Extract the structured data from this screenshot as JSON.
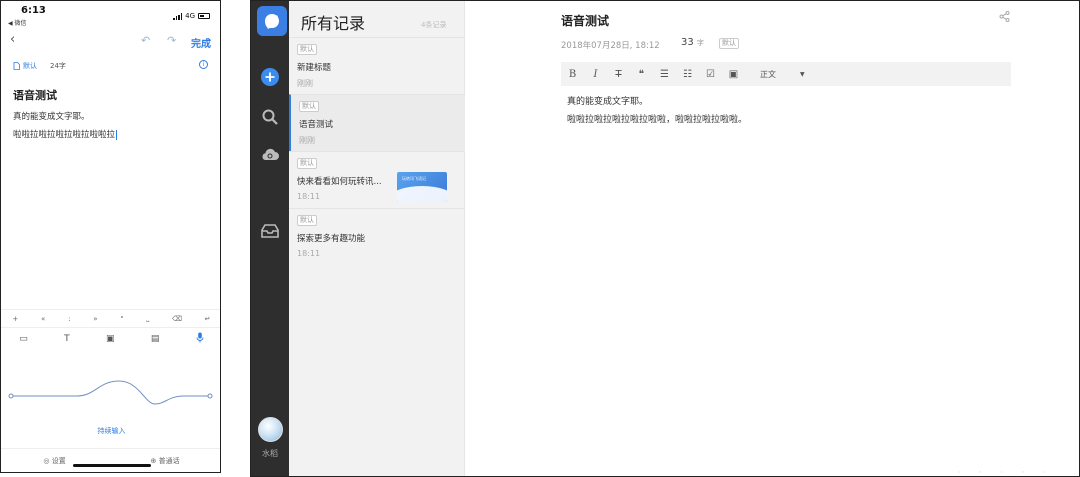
{
  "phone": {
    "status": {
      "time": "6:13",
      "back_app": "◀ 微信",
      "network": "4G"
    },
    "nav": {
      "back_icon": "‹",
      "undo_icon": "↶",
      "redo_icon": "↷",
      "done_label": "完成"
    },
    "meta": {
      "notebook": "默认",
      "word_count": "24字",
      "info_icon": "i"
    },
    "note": {
      "title": "语音测试",
      "line1": "真的能变成文字耶。",
      "line2": "啦啦拉啦拉啦拉啦拉啦啦拉"
    },
    "key_row": [
      "+",
      "«",
      ":",
      "»",
      "\"",
      "⎵",
      "⌫",
      "↵"
    ],
    "tool_row": {
      "image_icon": "▭",
      "text_icon": "T",
      "chat_icon": "▣",
      "card_icon": "▤",
      "mic_icon": "🎤"
    },
    "listening_label": "持续输入",
    "bottom": {
      "settings_label": "设置",
      "language_label": "普通话"
    }
  },
  "desktop": {
    "rail": {
      "user_name": "水稻"
    },
    "list": {
      "title": "所有记录",
      "count": "4条记录",
      "notes": [
        {
          "tag": "默认",
          "title": "新建标题",
          "time": "刚刚"
        },
        {
          "tag": "默认",
          "title": "语音测试",
          "time": "刚刚"
        },
        {
          "tag": "默认",
          "title": "快来看看如何玩转讯...",
          "time": "18:11",
          "thumb_text": "玩转讯飞语记"
        },
        {
          "tag": "默认",
          "title": "探索更多有趣功能",
          "time": "18:11"
        }
      ]
    },
    "editor": {
      "title": "语音测试",
      "date": "2018年07月28日, 18:12",
      "count_num": "33",
      "count_unit": "字",
      "tag": "默认",
      "share_icon": "⋖",
      "toolbar": {
        "bold": "B",
        "italic": "I",
        "strike": "T",
        "quote": "❝",
        "ul": "☰",
        "ol": "☷",
        "check": "☑",
        "image": "▣",
        "paragraph": "正文",
        "caret": "▼"
      },
      "body_line1": "真的能变成文字耶。",
      "body_line2": "啦啦拉啦拉啦拉啦拉啦啦，啦啦拉啦拉啦啦。",
      "footer_icons": "◦ ◦ ◦ ◦ ◦"
    }
  },
  "colors": {
    "accent": "#2f7de1",
    "rail": "#2e2e2e",
    "list_bg": "#f2f2f2",
    "logo": "#3b7fe4"
  }
}
